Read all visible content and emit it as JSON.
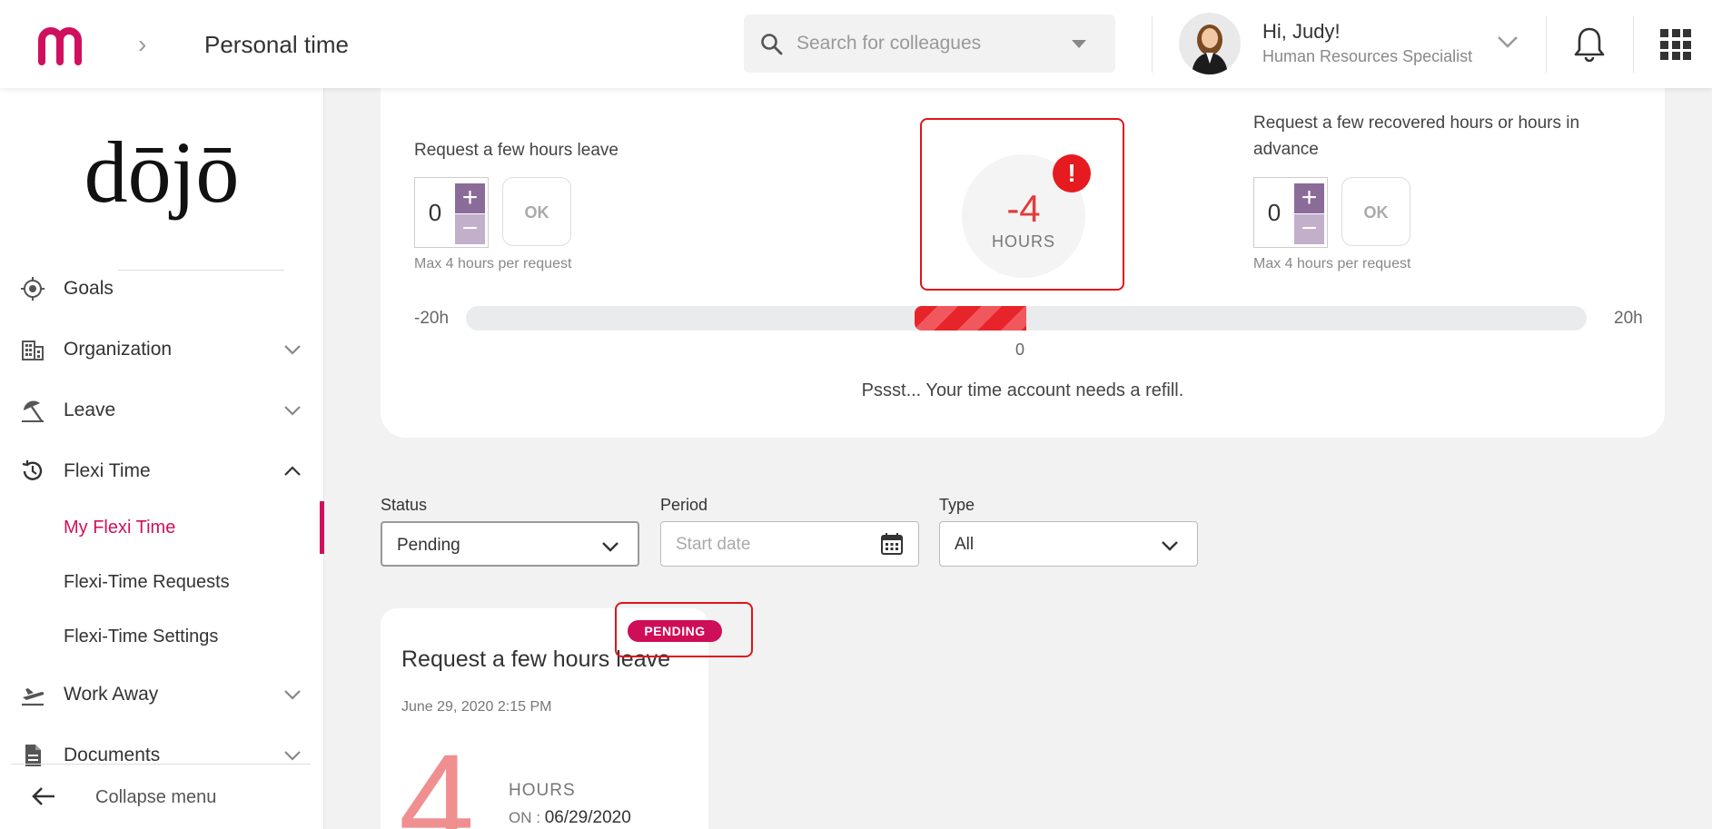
{
  "header": {
    "breadcrumb_title": "Personal time",
    "search_placeholder": "Search for colleagues",
    "user_greeting": "Hi, Judy!",
    "user_role": "Human Resources Specialist"
  },
  "sidebar": {
    "brand": "dōjō",
    "items": [
      {
        "label": "Goals",
        "icon": "target-icon"
      },
      {
        "label": "Organization",
        "icon": "building-icon"
      },
      {
        "label": "Leave",
        "icon": "beach-umbrella-icon"
      },
      {
        "label": "Flexi Time",
        "icon": "history-clock-icon"
      }
    ],
    "flexi_sub": [
      "My Flexi Time",
      "Flexi-Time Requests",
      "Flexi-Time Settings"
    ],
    "items_after": [
      {
        "label": "Work Away",
        "icon": "airplane-icon"
      },
      {
        "label": "Documents",
        "icon": "document-icon"
      }
    ],
    "collapse_label": "Collapse menu"
  },
  "balance": {
    "left_title": "Request a few hours leave",
    "right_title": "Request a few recovered hours or hours in advance",
    "left_value": "0",
    "right_value": "0",
    "ok_label": "OK",
    "max_note": "Max 4 hours per request",
    "hours_value": "-4",
    "hours_unit": "HOURS",
    "alert_mark": "!",
    "bar_min_label": "-20h",
    "bar_max_label": "20h",
    "bar_zero_label": "0",
    "bar_range": [
      -20,
      20
    ],
    "bar_value": -4,
    "refill_message": "Pssst... Your time account needs a refill."
  },
  "filters": {
    "status_label": "Status",
    "status_value": "Pending",
    "period_label": "Period",
    "period_placeholder": "Start date",
    "type_label": "Type",
    "type_value": "All"
  },
  "request_card": {
    "badge": "PENDING",
    "title": "Request a few hours leave",
    "date": "June 29, 2020 2:15 PM",
    "hours": "4",
    "unit": "HOURS",
    "on_label": "ON :",
    "on_date": "06/29/2020"
  },
  "colors": {
    "brand": "#d0105e",
    "alert": "#e0141b",
    "stepper_plus": "#8b6c99",
    "stepper_minus": "#c2afc9"
  }
}
